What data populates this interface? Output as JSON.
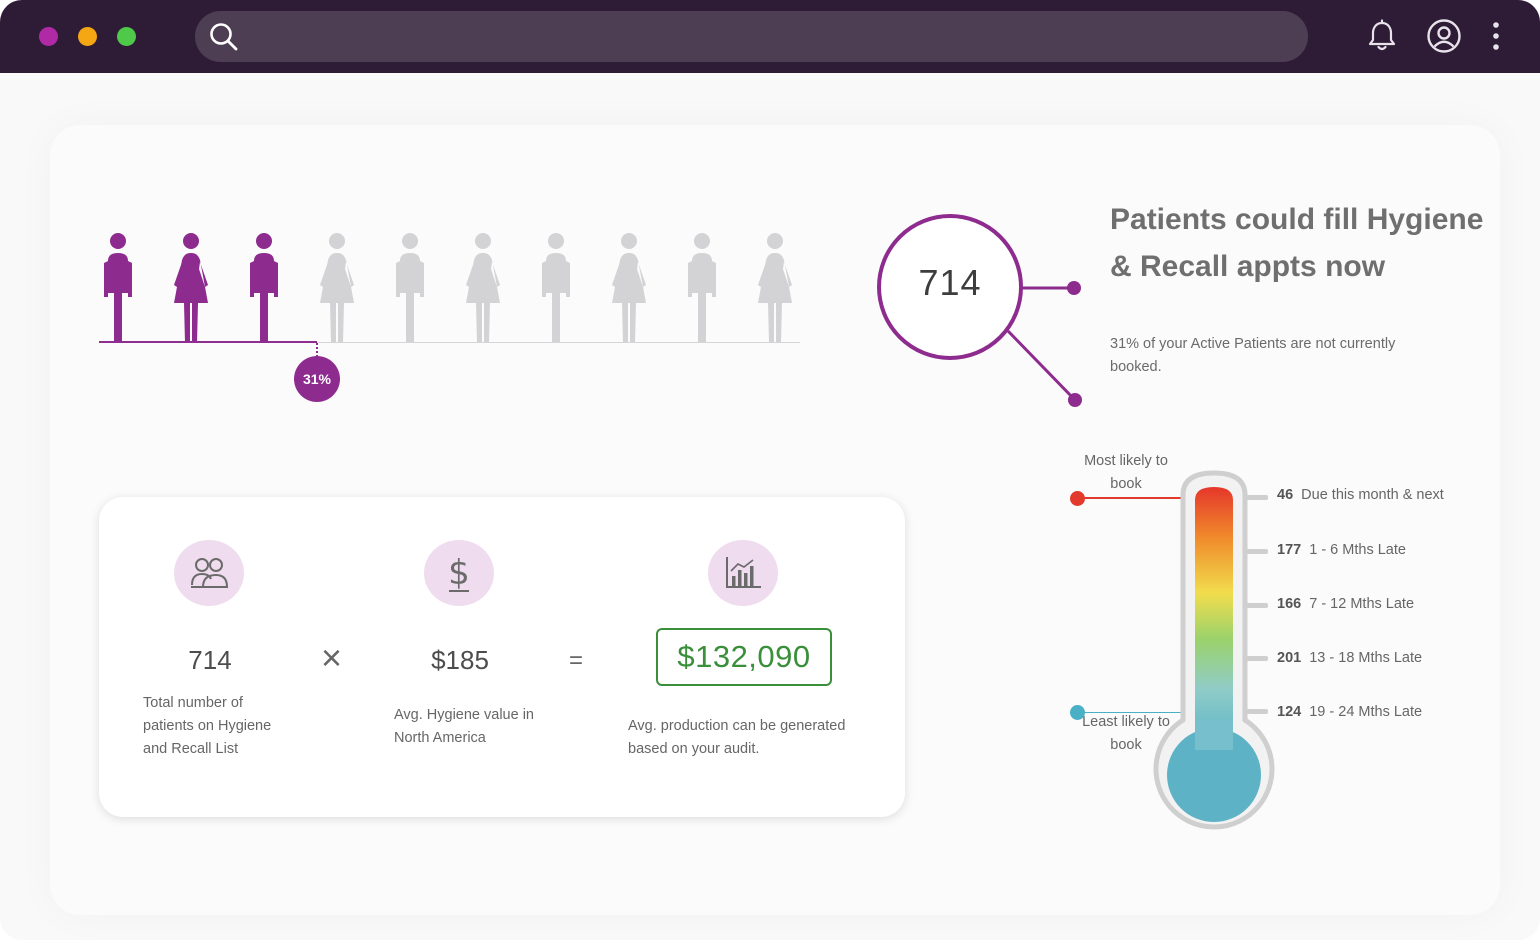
{
  "window": {
    "controls": [
      "close",
      "minimize",
      "maximize"
    ],
    "search": {
      "placeholder": ""
    },
    "icons": [
      "search-icon",
      "bell-icon",
      "user-circle-icon",
      "kebab-menu-icon"
    ]
  },
  "colors": {
    "titlebar": "#2e1b36",
    "accent_purple": "#8e2b8f",
    "inactive_person": "#d3d3d6",
    "result_green": "#3a8f3a",
    "hot_red": "#e23b2e",
    "cold_teal": "#4ab0c6"
  },
  "people_graphic": {
    "total_figures": 10,
    "highlighted_figures": 3,
    "figure_types": [
      "male",
      "female",
      "male",
      "female",
      "male",
      "female",
      "male",
      "female",
      "male",
      "female"
    ],
    "badge": "31%"
  },
  "summary": {
    "count": "714",
    "headline": "Patients could fill Hygiene & Recall appts now",
    "subtext": "31% of your Active Patients are not currently booked."
  },
  "calculator": {
    "items": [
      {
        "icon": "people-icon",
        "value": "714",
        "description": "Total number of patients on Hygiene and Recall List"
      },
      {
        "icon": "dollar-icon",
        "value": "$185",
        "description": "Avg. Hygiene value in North America"
      },
      {
        "icon": "bar-chart-icon",
        "value": "$132,090",
        "description": "Avg. production can be generated based on your audit."
      }
    ],
    "multiply_symbol": "×",
    "equals_symbol": "="
  },
  "thermometer": {
    "top_label": "Most likely to book",
    "bottom_label": "Least likely to book",
    "scale": [
      {
        "count": "46",
        "label": "Due this month & next"
      },
      {
        "count": "177",
        "label": "1 - 6 Mths Late"
      },
      {
        "count": "166",
        "label": "7 - 12 Mths Late"
      },
      {
        "count": "201",
        "label": "13 - 18 Mths Late"
      },
      {
        "count": "124",
        "label": "19 - 24 Mths Late"
      }
    ]
  }
}
